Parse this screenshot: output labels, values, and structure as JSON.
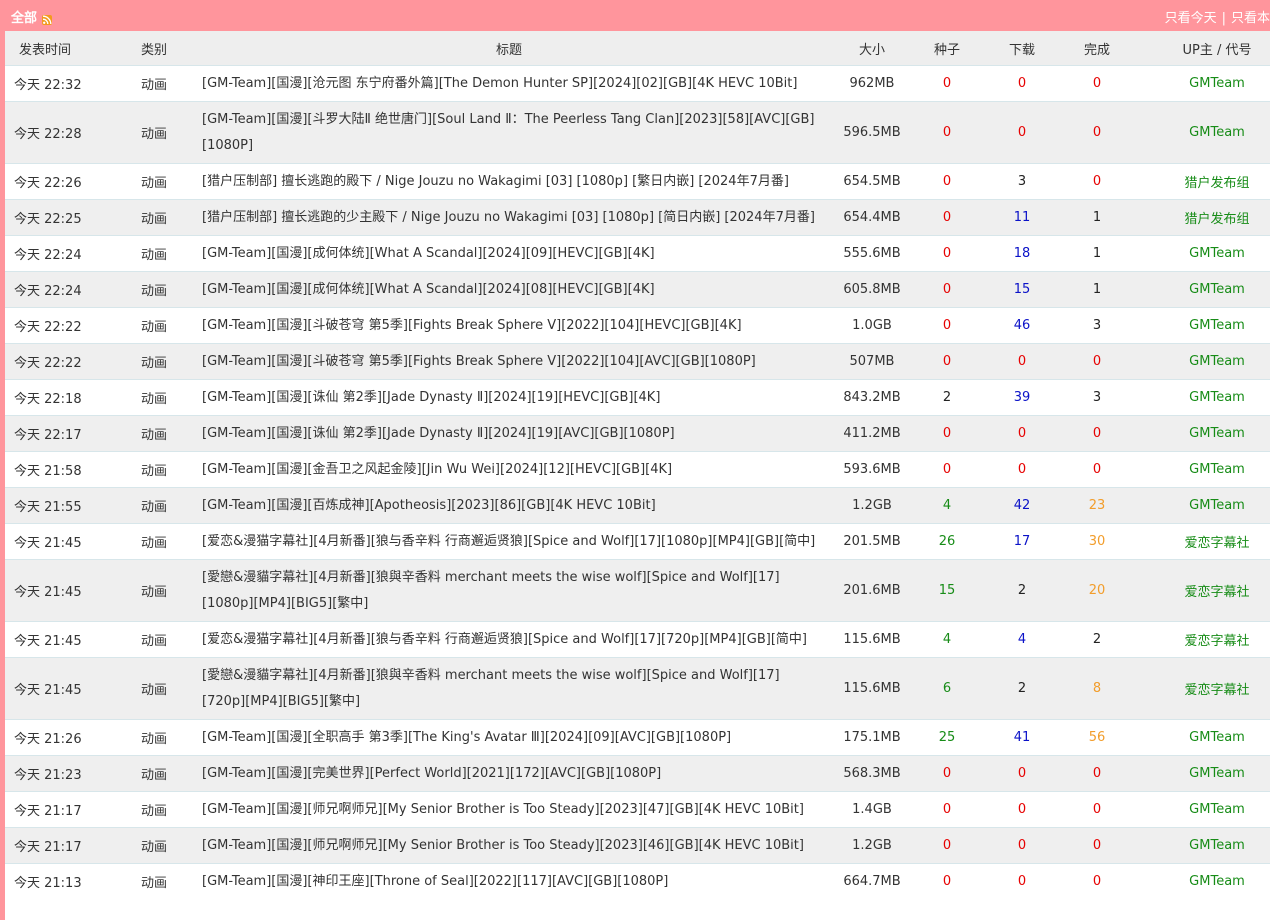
{
  "header": {
    "title": "全部",
    "links": [
      "只看今天",
      "只看本"
    ],
    "separator": "|"
  },
  "columns": {
    "time": "发表时间",
    "category": "类别",
    "title": "标题",
    "size": "大小",
    "seeds": "种子",
    "downloads": "下载",
    "complete": "完成",
    "uploader": "UP主 / 代号"
  },
  "colors": {
    "accent": "#ff959c",
    "zero": "#e60000",
    "downloads": "#0b12c8",
    "seeds": "#178c17",
    "complete_high": "#f29d2b",
    "uploader": "#178c17"
  },
  "rows": [
    {
      "time": "今天 22:32",
      "category": "动画",
      "title": "[GM-Team][国漫][沧元图 东宁府番外篇][The Demon Hunter SP][2024][02][GB][4K HEVC 10Bit]",
      "size": "962MB",
      "seeds": "0",
      "downloads": "0",
      "complete": "0",
      "uploader": "GMTeam"
    },
    {
      "time": "今天 22:28",
      "category": "动画",
      "title": "[GM-Team][国漫][斗罗大陆Ⅱ 绝世唐门][Soul Land Ⅱ：The Peerless Tang Clan][2023][58][AVC][GB][1080P]",
      "size": "596.5MB",
      "seeds": "0",
      "downloads": "0",
      "complete": "0",
      "uploader": "GMTeam"
    },
    {
      "time": "今天 22:26",
      "category": "动画",
      "title": "[猎户压制部] 擅长逃跑的殿下 / Nige Jouzu no Wakagimi [03] [1080p] [繁日内嵌] [2024年7月番]",
      "size": "654.5MB",
      "seeds": "0",
      "downloads": "3",
      "complete": "0",
      "uploader": "猎户发布组"
    },
    {
      "time": "今天 22:25",
      "category": "动画",
      "title": "[猎户压制部] 擅长逃跑的少主殿下 / Nige Jouzu no Wakagimi [03] [1080p] [简日内嵌] [2024年7月番]",
      "size": "654.4MB",
      "seeds": "0",
      "downloads": "11",
      "complete": "1",
      "uploader": "猎户发布组"
    },
    {
      "time": "今天 22:24",
      "category": "动画",
      "title": "[GM-Team][国漫][成何体统][What A Scandal][2024][09][HEVC][GB][4K]",
      "size": "555.6MB",
      "seeds": "0",
      "downloads": "18",
      "complete": "1",
      "uploader": "GMTeam"
    },
    {
      "time": "今天 22:24",
      "category": "动画",
      "title": "[GM-Team][国漫][成何体统][What A Scandal][2024][08][HEVC][GB][4K]",
      "size": "605.8MB",
      "seeds": "0",
      "downloads": "15",
      "complete": "1",
      "uploader": "GMTeam"
    },
    {
      "time": "今天 22:22",
      "category": "动画",
      "title": "[GM-Team][国漫][斗破苍穹 第5季][Fights Break Sphere Ⅴ][2022][104][HEVC][GB][4K]",
      "size": "1.0GB",
      "seeds": "0",
      "downloads": "46",
      "complete": "3",
      "uploader": "GMTeam"
    },
    {
      "time": "今天 22:22",
      "category": "动画",
      "title": "[GM-Team][国漫][斗破苍穹 第5季][Fights Break Sphere Ⅴ][2022][104][AVC][GB][1080P]",
      "size": "507MB",
      "seeds": "0",
      "downloads": "0",
      "complete": "0",
      "uploader": "GMTeam"
    },
    {
      "time": "今天 22:18",
      "category": "动画",
      "title": "[GM-Team][国漫][诛仙 第2季][Jade Dynasty Ⅱ][2024][19][HEVC][GB][4K]",
      "size": "843.2MB",
      "seeds": "2",
      "downloads": "39",
      "complete": "3",
      "uploader": "GMTeam"
    },
    {
      "time": "今天 22:17",
      "category": "动画",
      "title": "[GM-Team][国漫][诛仙 第2季][Jade Dynasty Ⅱ][2024][19][AVC][GB][1080P]",
      "size": "411.2MB",
      "seeds": "0",
      "downloads": "0",
      "complete": "0",
      "uploader": "GMTeam"
    },
    {
      "time": "今天 21:58",
      "category": "动画",
      "title": "[GM-Team][国漫][金吾卫之风起金陵][Jin Wu Wei][2024][12][HEVC][GB][4K]",
      "size": "593.6MB",
      "seeds": "0",
      "downloads": "0",
      "complete": "0",
      "uploader": "GMTeam"
    },
    {
      "time": "今天 21:55",
      "category": "动画",
      "title": "[GM-Team][国漫][百炼成神][Apotheosis][2023][86][GB][4K HEVC 10Bit]",
      "size": "1.2GB",
      "seeds": "4",
      "downloads": "42",
      "complete": "23",
      "uploader": "GMTeam"
    },
    {
      "time": "今天 21:45",
      "category": "动画",
      "title": "[爱恋&漫猫字幕社][4月新番][狼与香辛料 行商邂逅贤狼][Spice and Wolf][17][1080p][MP4][GB][简中]",
      "size": "201.5MB",
      "seeds": "26",
      "downloads": "17",
      "complete": "30",
      "uploader": "爱恋字幕社"
    },
    {
      "time": "今天 21:45",
      "category": "动画",
      "title": "[愛戀&漫貓字幕社][4月新番][狼與辛香料 merchant meets the wise wolf][Spice and Wolf][17][1080p][MP4][BIG5][繁中]",
      "size": "201.6MB",
      "seeds": "15",
      "downloads": "2",
      "complete": "20",
      "uploader": "爱恋字幕社"
    },
    {
      "time": "今天 21:45",
      "category": "动画",
      "title": "[爱恋&漫猫字幕社][4月新番][狼与香辛料 行商邂逅贤狼][Spice and Wolf][17][720p][MP4][GB][简中]",
      "size": "115.6MB",
      "seeds": "4",
      "downloads": "4",
      "complete": "2",
      "uploader": "爱恋字幕社"
    },
    {
      "time": "今天 21:45",
      "category": "动画",
      "title": "[愛戀&漫貓字幕社][4月新番][狼與辛香料 merchant meets the wise wolf][Spice and Wolf][17][720p][MP4][BIG5][繁中]",
      "size": "115.6MB",
      "seeds": "6",
      "downloads": "2",
      "complete": "8",
      "uploader": "爱恋字幕社"
    },
    {
      "time": "今天 21:26",
      "category": "动画",
      "title": "[GM-Team][国漫][全职高手 第3季][The King's Avatar Ⅲ][2024][09][AVC][GB][1080P]",
      "size": "175.1MB",
      "seeds": "25",
      "downloads": "41",
      "complete": "56",
      "uploader": "GMTeam"
    },
    {
      "time": "今天 21:23",
      "category": "动画",
      "title": "[GM-Team][国漫][完美世界][Perfect World][2021][172][AVC][GB][1080P]",
      "size": "568.3MB",
      "seeds": "0",
      "downloads": "0",
      "complete": "0",
      "uploader": "GMTeam"
    },
    {
      "time": "今天 21:17",
      "category": "动画",
      "title": "[GM-Team][国漫][师兄啊师兄][My Senior Brother is Too Steady][2023][47][GB][4K HEVC 10Bit]",
      "size": "1.4GB",
      "seeds": "0",
      "downloads": "0",
      "complete": "0",
      "uploader": "GMTeam"
    },
    {
      "time": "今天 21:17",
      "category": "动画",
      "title": "[GM-Team][国漫][师兄啊师兄][My Senior Brother is Too Steady][2023][46][GB][4K HEVC 10Bit]",
      "size": "1.2GB",
      "seeds": "0",
      "downloads": "0",
      "complete": "0",
      "uploader": "GMTeam"
    },
    {
      "time": "今天 21:13",
      "category": "动画",
      "title": "[GM-Team][国漫][神印王座][Throne of Seal][2022][117][AVC][GB][1080P]",
      "size": "664.7MB",
      "seeds": "0",
      "downloads": "0",
      "complete": "0",
      "uploader": "GMTeam"
    }
  ]
}
